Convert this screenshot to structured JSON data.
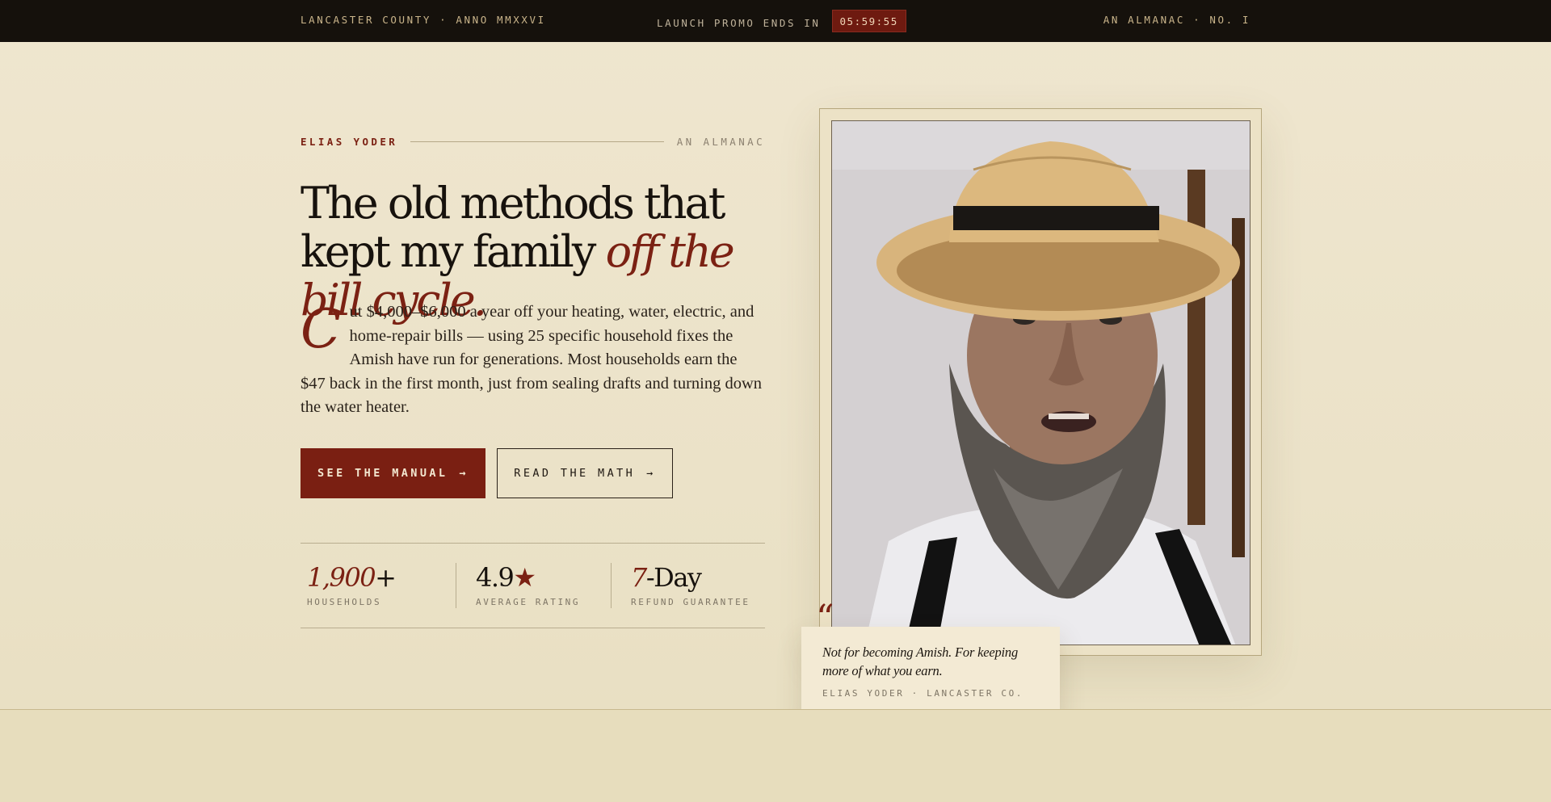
{
  "topbar": {
    "left_text": "LANCASTER COUNTY · ANNO MMXXVI",
    "promo_label": "LAUNCH PROMO ENDS IN",
    "timer": "05:59:55",
    "right_text": "AN ALMANAC · NO. I"
  },
  "hero": {
    "eyebrow_author": "ELIAS YODER",
    "eyebrow_tag": "AN ALMANAC",
    "headline_plain": "The old methods that kept my family",
    "headline_accent": "off the bill cycle.",
    "lede_dropcap": "C",
    "lede_rest": "ut $4,000–$6,000 a year off your heating, water, electric, and home-repair bills — using 25 specific household fixes the Amish have run for generations. Most households earn the $47 back in the first month, just from sealing drafts and turning down the water heater.",
    "cta_primary": "SEE THE MANUAL",
    "cta_secondary": "READ THE MATH",
    "arrow": "→"
  },
  "stats": [
    {
      "value": "1,900",
      "suffix": "+",
      "label": "HOUSEHOLDS"
    },
    {
      "value": "4.9",
      "suffix": "★",
      "label": "AVERAGE RATING"
    },
    {
      "value": "7",
      "suffix": "-Day",
      "label": "REFUND GUARANTEE"
    }
  ],
  "portrait": {
    "subject": "Elias Yoder portrait in straw hat"
  },
  "quote": {
    "mark": "“",
    "text": "Not for becoming Amish. For keeping more of what you earn.",
    "attribution": "ELIAS YODER · LANCASTER CO."
  },
  "colors": {
    "accent": "#7b2113",
    "topbar": "#15110c",
    "paper": "#ece3c9"
  }
}
